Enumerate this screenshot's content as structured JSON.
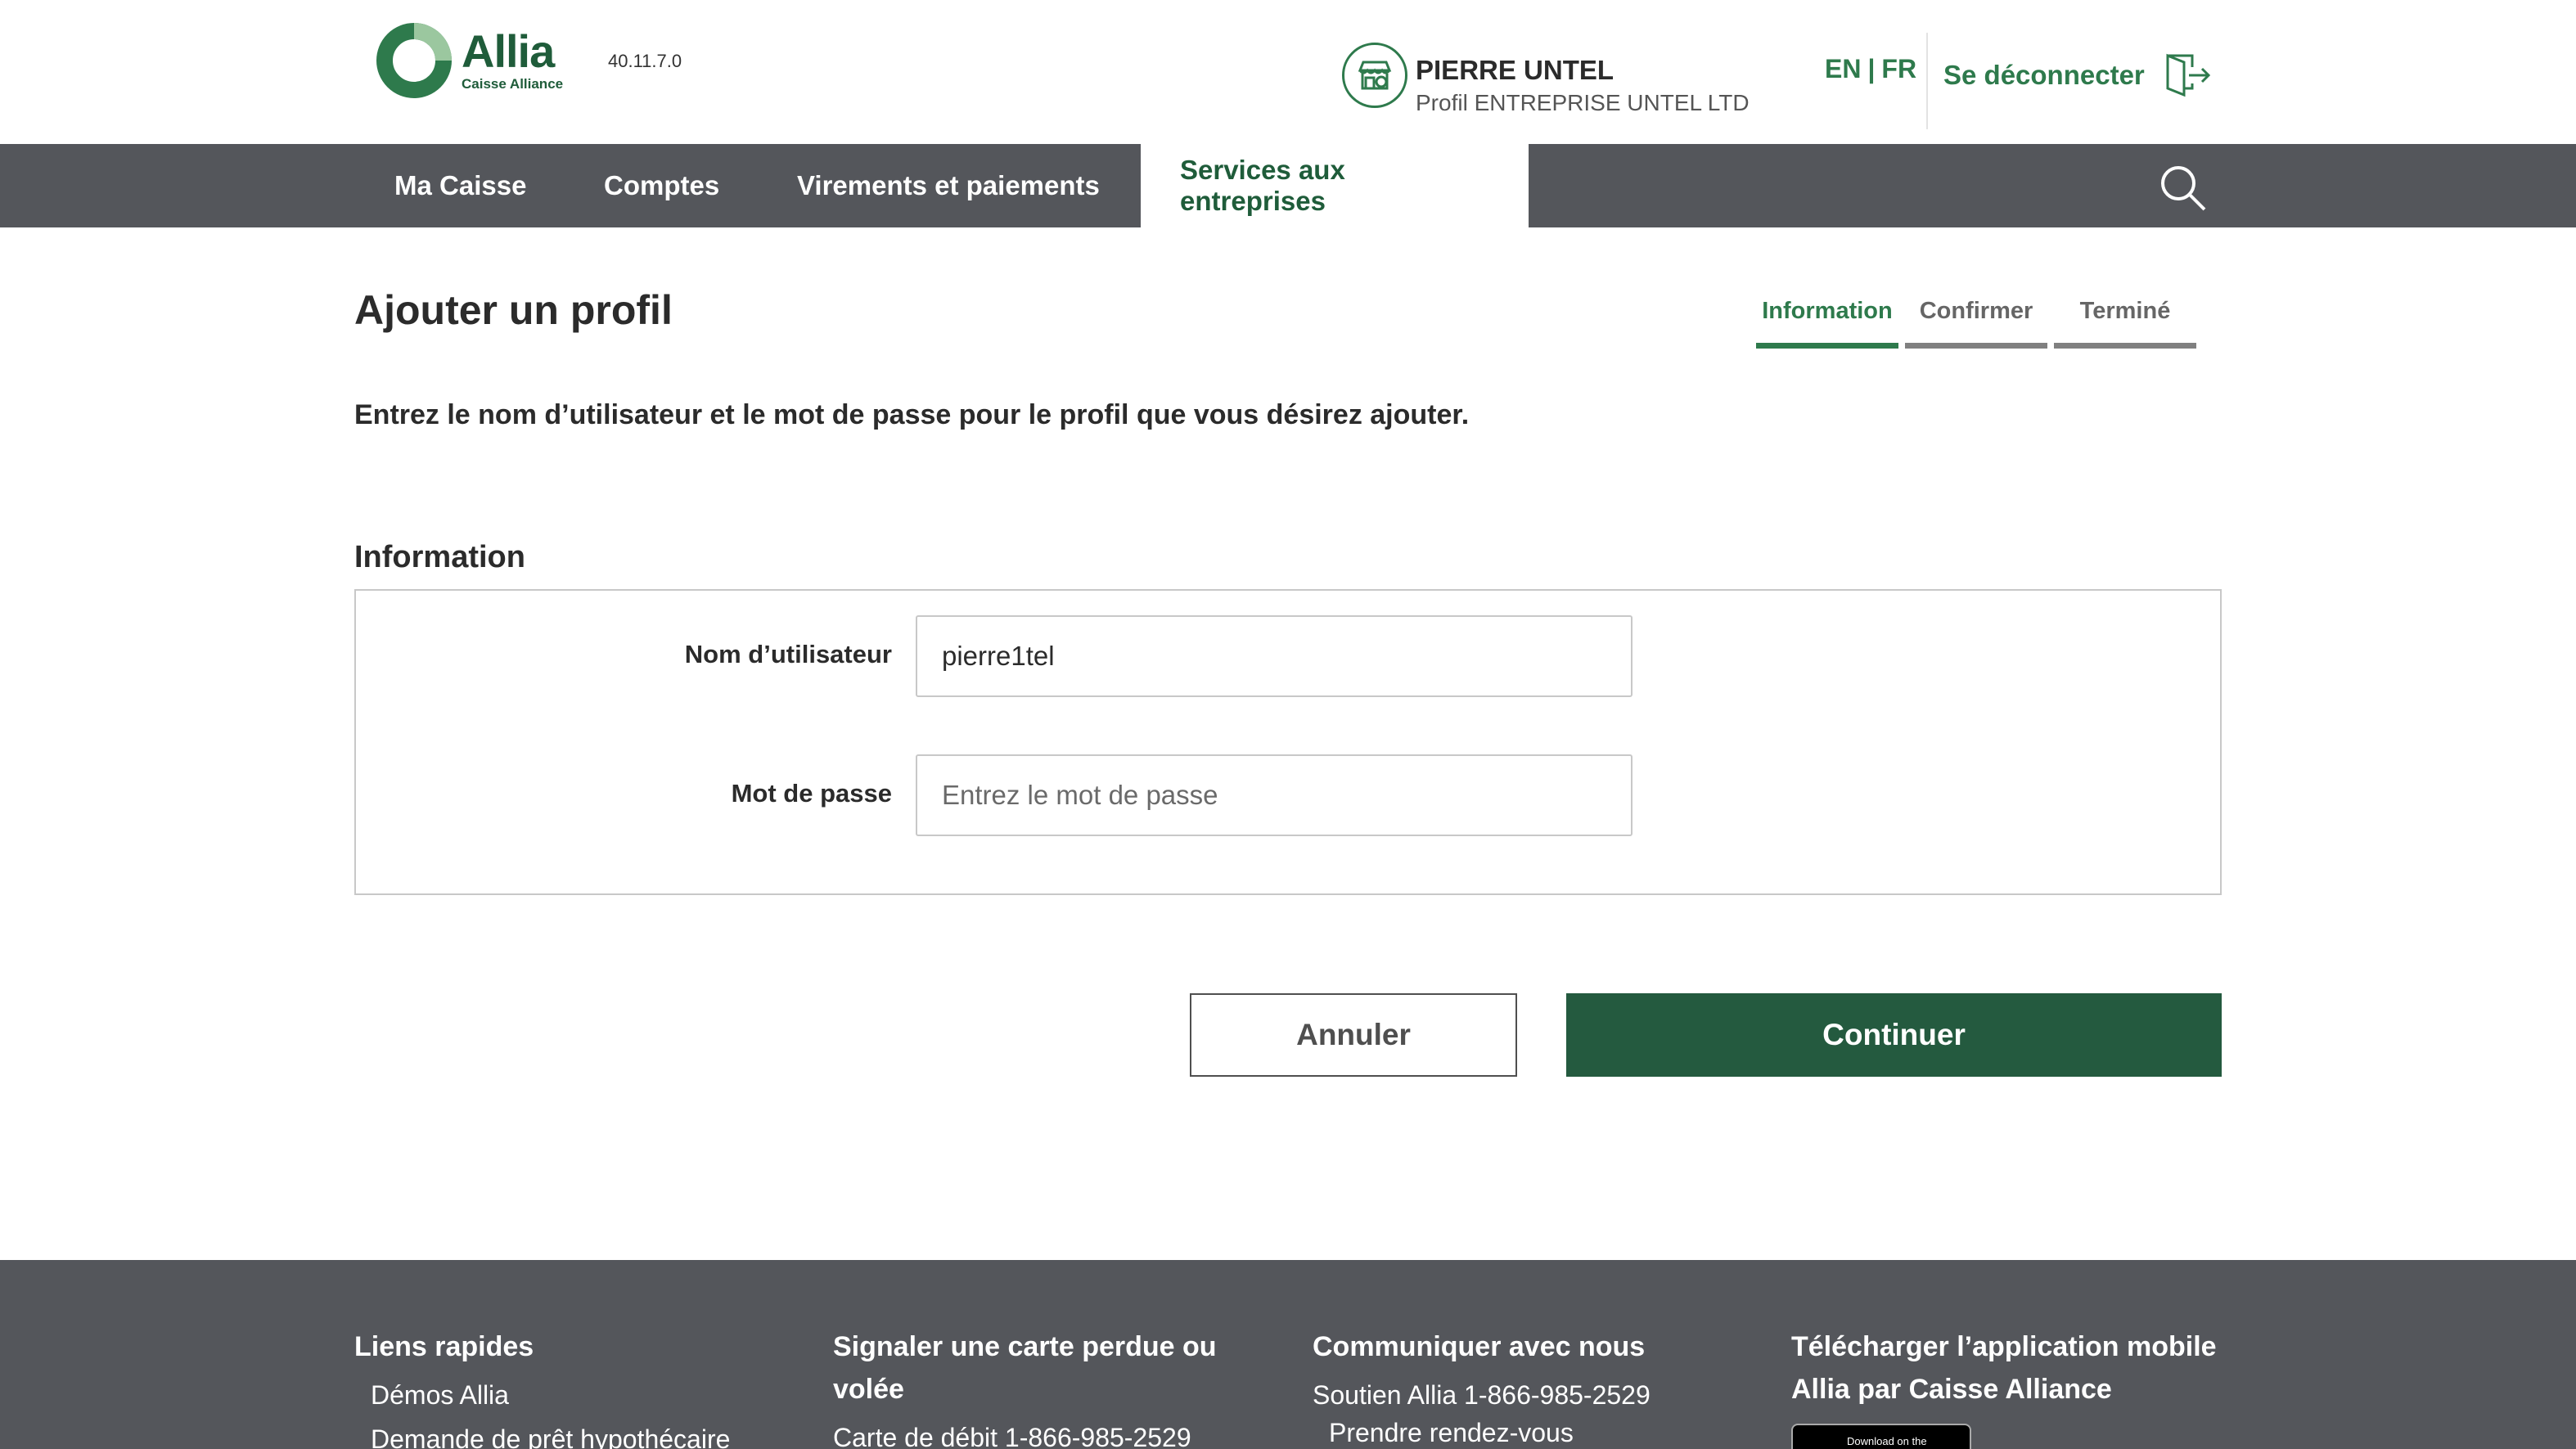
{
  "header": {
    "brand_name": "Allia",
    "brand_sub": "Caisse Alliance",
    "version": "40.11.7.0",
    "user_name": "PIERRE UNTEL",
    "user_profile": "Profil ENTREPRISE UNTEL LTD",
    "lang_en": "EN",
    "lang_sep": "|",
    "lang_fr": "FR",
    "logout_label": "Se déconnecter"
  },
  "nav": {
    "items": [
      {
        "label": "Ma Caisse"
      },
      {
        "label": "Comptes"
      },
      {
        "label": "Virements et paiements"
      },
      {
        "label": "Services aux entreprises"
      }
    ]
  },
  "main": {
    "title": "Ajouter un profil",
    "steps": [
      {
        "label": "Information"
      },
      {
        "label": "Confirmer"
      },
      {
        "label": "Terminé"
      }
    ],
    "intro": "Entrez le nom d’utilisateur et le mot de passe pour le profil que vous désirez ajouter.",
    "section_title": "Information",
    "username_label": "Nom d’utilisateur",
    "username_value": "pierre1tel",
    "password_label": "Mot de passe",
    "password_placeholder": "Entrez le mot de passe",
    "cancel_label": "Annuler",
    "continue_label": "Continuer"
  },
  "footer": {
    "col1": {
      "heading": "Liens rapides",
      "links": [
        "Démos Allia",
        "Demande de prêt hypothécaire"
      ]
    },
    "col2": {
      "heading": "Signaler une carte perdue ou volée",
      "links": [
        "Carte de débit 1-866-985-2529"
      ]
    },
    "col3": {
      "heading": "Communiquer avec nous",
      "links": [
        "Soutien Allia 1-866-985-2529",
        "Prendre rendez-vous"
      ]
    },
    "col4": {
      "heading": "Télécharger l’application mobile Allia par Caisse Alliance",
      "badge": "Download on the"
    }
  },
  "colors": {
    "brand_green": "#2e7a4c",
    "dark_green_button": "#245a3f",
    "nav_gray": "#54565b"
  }
}
